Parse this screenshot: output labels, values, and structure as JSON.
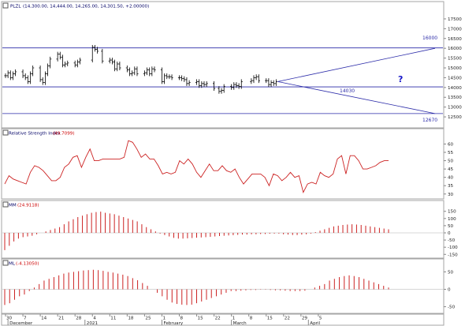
{
  "colors": {
    "background": "#ffffff",
    "frame": "#a6a6a6",
    "bars": "#000000",
    "support_lines": "#2a2aa8",
    "indicator": "#cc2222",
    "header_text": "#000066",
    "header_value": "#cc0000",
    "question": "#1515c8",
    "zero_line": "#b0b0b0"
  },
  "panels": {
    "price": {
      "header_symbol": "PLZL",
      "header_ohlc": "(14,300.00, 14,444.00, 14,265.00, 14,301.50, +2.00000)",
      "y_ticks": [
        "17500",
        "17000",
        "16500",
        "16000",
        "15500",
        "15000",
        "14500",
        "14000",
        "13500",
        "13000",
        "12500"
      ],
      "annotations": {
        "upper_target": "16000",
        "lower_target": "12670",
        "support": "14030",
        "question": "?"
      }
    },
    "rsi": {
      "header_name": "Relative Strength Index",
      "header_value": "(49.7099)",
      "y_ticks": [
        "60",
        "55",
        "50",
        "45",
        "40",
        "35",
        "30"
      ]
    },
    "mm": {
      "header_name": "MM",
      "header_value": "(24.9118)",
      "y_ticks": [
        "150",
        "100",
        "50",
        "0",
        "-50",
        "-100",
        "-150"
      ]
    },
    "ml": {
      "header_name": "ML",
      "header_value": "(-4.13050)",
      "y_ticks": [
        "50",
        "0",
        "-50"
      ]
    }
  },
  "x_axis": {
    "day_labels": [
      "30",
      "7",
      "14",
      "21",
      "28",
      "4",
      "11",
      "18",
      "25",
      "1",
      "8",
      "15",
      "22",
      "1",
      "8",
      "15",
      "22",
      "29",
      "5"
    ],
    "month_labels": [
      "December",
      "2021",
      "February",
      "March",
      "April"
    ]
  },
  "chart_data": [
    {
      "type": "ohlc",
      "panel": "price",
      "ylim": [
        12100,
        17900
      ],
      "header": "PLZL (14,300.00, 14,444.00, 14,265.00, 14,301.50, +2.00000)",
      "x": [
        "2020-11-30",
        "2020-12-01",
        "2020-12-02",
        "2020-12-03",
        "2020-12-04",
        "2020-12-07",
        "2020-12-08",
        "2020-12-09",
        "2020-12-10",
        "2020-12-11",
        "2020-12-14",
        "2020-12-15",
        "2020-12-16",
        "2020-12-17",
        "2020-12-18",
        "2020-12-21",
        "2020-12-22",
        "2020-12-23",
        "2020-12-24",
        "2020-12-25",
        "2020-12-28",
        "2020-12-29",
        "2020-12-30",
        "2021-01-04",
        "2021-01-05",
        "2021-01-06",
        "2021-01-08",
        "2021-01-11",
        "2021-01-12",
        "2021-01-13",
        "2021-01-14",
        "2021-01-15",
        "2021-01-18",
        "2021-01-19",
        "2021-01-20",
        "2021-01-21",
        "2021-01-22",
        "2021-01-25",
        "2021-01-26",
        "2021-01-27",
        "2021-01-28",
        "2021-01-29",
        "2021-02-01",
        "2021-02-02",
        "2021-02-03",
        "2021-02-04",
        "2021-02-05",
        "2021-02-08",
        "2021-02-09",
        "2021-02-10",
        "2021-02-11",
        "2021-02-12",
        "2021-02-15",
        "2021-02-16",
        "2021-02-17",
        "2021-02-18",
        "2021-02-19",
        "2021-02-22",
        "2021-02-24",
        "2021-02-25",
        "2021-02-26",
        "2021-03-01",
        "2021-03-02",
        "2021-03-03",
        "2021-03-04",
        "2021-03-05",
        "2021-03-09",
        "2021-03-10",
        "2021-03-11",
        "2021-03-12",
        "2021-03-15",
        "2021-03-16",
        "2021-03-17",
        "2021-03-18",
        "2021-03-19"
      ],
      "close": [
        14600,
        14750,
        14500,
        14700,
        14800,
        14600,
        14500,
        14300,
        14700,
        15000,
        14400,
        14250,
        14700,
        15100,
        15450,
        15700,
        15550,
        15150,
        15200,
        15250,
        15150,
        15300,
        15400,
        16050,
        15950,
        15850,
        15350,
        15400,
        15300,
        14950,
        15200,
        15000,
        14900,
        14700,
        14750,
        14950,
        14700,
        14750,
        14900,
        14700,
        14950,
        14900,
        14300,
        14600,
        14550,
        14550,
        14500,
        14500,
        14450,
        14400,
        14200,
        14250,
        14300,
        14100,
        14200,
        14150,
        14200,
        13950,
        13800,
        13850,
        14050,
        14000,
        14150,
        14100,
        14050,
        14300,
        14350,
        14500,
        14550,
        14350,
        14350,
        14150,
        14250,
        14200,
        14300
      ],
      "support_lines": [
        16020,
        14030,
        12670
      ],
      "projection_targets": [
        16000,
        12670
      ]
    },
    {
      "type": "line",
      "panel": "rsi",
      "title": "Relative Strength Index",
      "ylim": [
        28,
        64
      ],
      "y": [
        36,
        41,
        39,
        38,
        37,
        36,
        43,
        47,
        46,
        44,
        41,
        38,
        38,
        40,
        46,
        48,
        52,
        53,
        46,
        52,
        57,
        50,
        50,
        51,
        51,
        51,
        51,
        51,
        52,
        62,
        61,
        57,
        52,
        54,
        51,
        51,
        47,
        42,
        43,
        42,
        43,
        50,
        48,
        51,
        48,
        43,
        40,
        44,
        48,
        44,
        44,
        47,
        44,
        43,
        45,
        40,
        36,
        39,
        42,
        42,
        42,
        40,
        35,
        42,
        41,
        38,
        40,
        43,
        40,
        41,
        31,
        36,
        37,
        36,
        43,
        41,
        40,
        42,
        51,
        53,
        42,
        53,
        53,
        50,
        45,
        45,
        46,
        47,
        49,
        50,
        50
      ]
    },
    {
      "type": "bar",
      "panel": "mm",
      "ylim": [
        -165,
        165
      ],
      "y": [
        -120,
        -90,
        -60,
        -40,
        -30,
        -25,
        -20,
        -10,
        0,
        10,
        20,
        30,
        40,
        60,
        80,
        95,
        110,
        120,
        130,
        140,
        145,
        148,
        140,
        135,
        130,
        120,
        110,
        100,
        90,
        80,
        60,
        40,
        25,
        10,
        -5,
        -15,
        -25,
        -35,
        -40,
        -40,
        -38,
        -36,
        -34,
        -32,
        -30,
        -28,
        -25,
        -22,
        -20,
        -18,
        -16,
        -14,
        -12,
        -12,
        -10,
        -10,
        -8,
        -8,
        -6,
        -5,
        -5,
        -10,
        -12,
        -15,
        -15,
        -12,
        -10,
        -5,
        5,
        15,
        25,
        35,
        45,
        50,
        55,
        58,
        60,
        58,
        55,
        50,
        45,
        40,
        35,
        30,
        25
      ]
    },
    {
      "type": "bar",
      "panel": "ml",
      "ylim": [
        -60,
        60
      ],
      "y": [
        -45,
        -40,
        -30,
        -20,
        -15,
        -5,
        5,
        15,
        25,
        30,
        35,
        40,
        45,
        48,
        50,
        52,
        54,
        55,
        56,
        55,
        53,
        50,
        48,
        45,
        42,
        38,
        32,
        26,
        18,
        10,
        0,
        -10,
        -20,
        -30,
        -38,
        -42,
        -44,
        -45,
        -44,
        -40,
        -35,
        -30,
        -25,
        -20,
        -15,
        -10,
        -5,
        -5,
        -4,
        -3,
        -2,
        -2,
        -1,
        -1,
        -2,
        -3,
        -3,
        -4,
        -5,
        -5,
        -5,
        -4,
        0,
        5,
        10,
        15,
        25,
        30,
        35,
        38,
        40,
        38,
        35,
        30,
        25,
        20,
        15,
        10,
        5
      ]
    }
  ]
}
